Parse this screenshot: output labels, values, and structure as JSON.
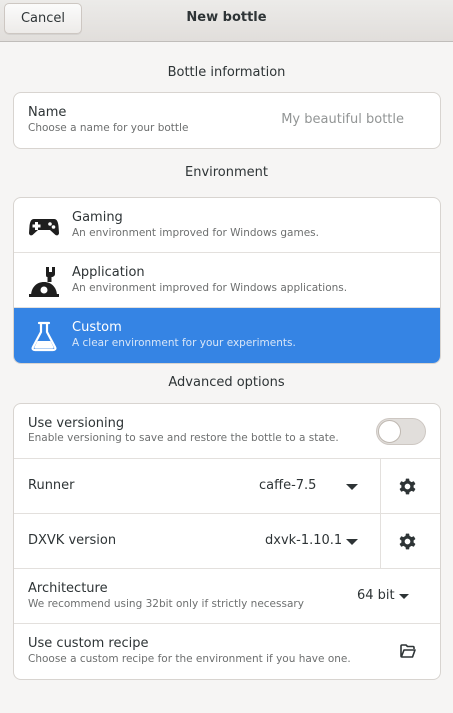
{
  "header": {
    "cancel_label": "Cancel",
    "title": "New bottle"
  },
  "bottle_info": {
    "section_title": "Bottle information",
    "name_label": "Name",
    "name_hint": "Choose a name for your bottle",
    "name_placeholder": "My beautiful bottle"
  },
  "environment": {
    "section_title": "Environment",
    "items": [
      {
        "title": "Gaming",
        "subtitle": "An environment improved for Windows games.",
        "icon": "gamepad-icon",
        "selected": false
      },
      {
        "title": "Application",
        "subtitle": "An environment improved for Windows applications.",
        "icon": "wrench-icon",
        "selected": false
      },
      {
        "title": "Custom",
        "subtitle": "A clear environment for your experiments.",
        "icon": "flask-icon",
        "selected": true
      }
    ]
  },
  "advanced": {
    "section_title": "Advanced options",
    "versioning": {
      "title": "Use versioning",
      "subtitle": "Enable versioning to save and restore the bottle to a state.",
      "enabled": false
    },
    "runner": {
      "title": "Runner",
      "value": "caffe-7.5"
    },
    "dxvk": {
      "title": "DXVK version",
      "value": "dxvk-1.10.1"
    },
    "architecture": {
      "title": "Architecture",
      "subtitle": "We recommend using 32bit only if strictly necessary",
      "value": "64 bit"
    },
    "recipe": {
      "title": "Use custom recipe",
      "subtitle": "Choose a custom recipe for the environment if you have one."
    }
  },
  "colors": {
    "accent": "#3584e4",
    "background": "#f6f5f4",
    "card": "#ffffff"
  }
}
